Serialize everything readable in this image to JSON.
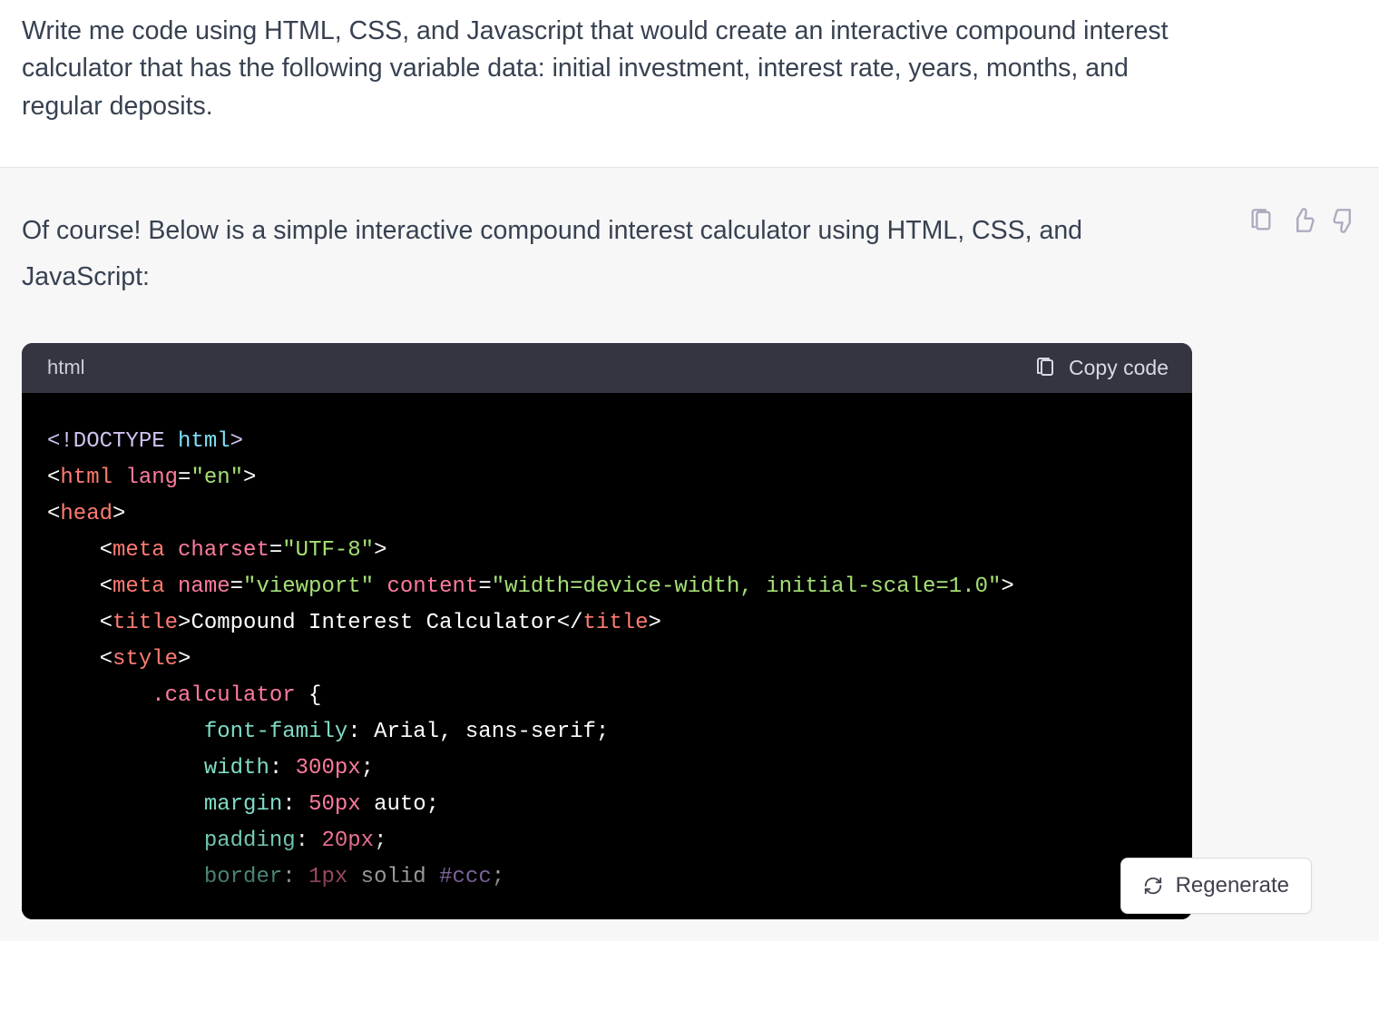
{
  "user": {
    "prompt": "Write me code using HTML, CSS, and Javascript that would create an interactive compound interest calculator that has the following variable data: initial investment, interest rate, years, months, and regular deposits."
  },
  "assistant": {
    "intro": "Of course! Below is a simple interactive compound interest calculator using HTML, CSS, and JavaScript:"
  },
  "codeblock": {
    "language": "html",
    "copy_label": "Copy code",
    "lines": [
      [
        {
          "t": "doctype",
          "v": "<!DOCTYPE "
        },
        {
          "t": "doctype-kw",
          "v": "html"
        },
        {
          "t": "doctype",
          "v": ">"
        }
      ],
      [
        {
          "t": "punct",
          "v": "<"
        },
        {
          "t": "tag",
          "v": "html"
        },
        {
          "t": "text",
          "v": " "
        },
        {
          "t": "attr",
          "v": "lang"
        },
        {
          "t": "punct",
          "v": "="
        },
        {
          "t": "string",
          "v": "\"en\""
        },
        {
          "t": "punct",
          "v": ">"
        }
      ],
      [
        {
          "t": "punct",
          "v": "<"
        },
        {
          "t": "tag",
          "v": "head"
        },
        {
          "t": "punct",
          "v": ">"
        }
      ],
      [
        {
          "t": "text",
          "v": "    "
        },
        {
          "t": "punct",
          "v": "<"
        },
        {
          "t": "tag",
          "v": "meta"
        },
        {
          "t": "text",
          "v": " "
        },
        {
          "t": "attr",
          "v": "charset"
        },
        {
          "t": "punct",
          "v": "="
        },
        {
          "t": "string",
          "v": "\"UTF-8\""
        },
        {
          "t": "punct",
          "v": ">"
        }
      ],
      [
        {
          "t": "text",
          "v": "    "
        },
        {
          "t": "punct",
          "v": "<"
        },
        {
          "t": "tag",
          "v": "meta"
        },
        {
          "t": "text",
          "v": " "
        },
        {
          "t": "attr",
          "v": "name"
        },
        {
          "t": "punct",
          "v": "="
        },
        {
          "t": "string",
          "v": "\"viewport\""
        },
        {
          "t": "text",
          "v": " "
        },
        {
          "t": "attr",
          "v": "content"
        },
        {
          "t": "punct",
          "v": "="
        },
        {
          "t": "string",
          "v": "\"width=device-width, initial-scale=1.0\""
        },
        {
          "t": "punct",
          "v": ">"
        }
      ],
      [
        {
          "t": "text",
          "v": "    "
        },
        {
          "t": "punct",
          "v": "<"
        },
        {
          "t": "tag",
          "v": "title"
        },
        {
          "t": "punct",
          "v": ">"
        },
        {
          "t": "text",
          "v": "Compound Interest Calculator"
        },
        {
          "t": "punct",
          "v": "</"
        },
        {
          "t": "tag",
          "v": "title"
        },
        {
          "t": "punct",
          "v": ">"
        }
      ],
      [
        {
          "t": "text",
          "v": "    "
        },
        {
          "t": "punct",
          "v": "<"
        },
        {
          "t": "tag",
          "v": "style"
        },
        {
          "t": "punct",
          "v": ">"
        }
      ],
      [
        {
          "t": "text",
          "v": "        "
        },
        {
          "t": "sel",
          "v": ".calculator"
        },
        {
          "t": "text",
          "v": " {"
        }
      ],
      [
        {
          "t": "text",
          "v": "            "
        },
        {
          "t": "prop",
          "v": "font-family"
        },
        {
          "t": "text",
          "v": ": Arial, sans-serif;"
        }
      ],
      [
        {
          "t": "text",
          "v": "            "
        },
        {
          "t": "prop",
          "v": "width"
        },
        {
          "t": "text",
          "v": ": "
        },
        {
          "t": "num",
          "v": "300px"
        },
        {
          "t": "text",
          "v": ";"
        }
      ],
      [
        {
          "t": "text",
          "v": "            "
        },
        {
          "t": "prop",
          "v": "margin"
        },
        {
          "t": "text",
          "v": ": "
        },
        {
          "t": "num",
          "v": "50px"
        },
        {
          "t": "text",
          "v": " auto;"
        }
      ],
      [
        {
          "t": "text",
          "v": "            "
        },
        {
          "t": "prop",
          "v": "padding"
        },
        {
          "t": "text",
          "v": ": "
        },
        {
          "t": "num",
          "v": "20px"
        },
        {
          "t": "text",
          "v": ";"
        }
      ],
      [
        {
          "t": "text",
          "v": "            "
        },
        {
          "t": "prop",
          "v": "border"
        },
        {
          "t": "text",
          "v": ": "
        },
        {
          "t": "num",
          "v": "1px"
        },
        {
          "t": "text",
          "v": " solid "
        },
        {
          "t": "const",
          "v": "#ccc"
        },
        {
          "t": "text",
          "v": ";"
        }
      ]
    ]
  },
  "buttons": {
    "regenerate": "Regenerate"
  }
}
